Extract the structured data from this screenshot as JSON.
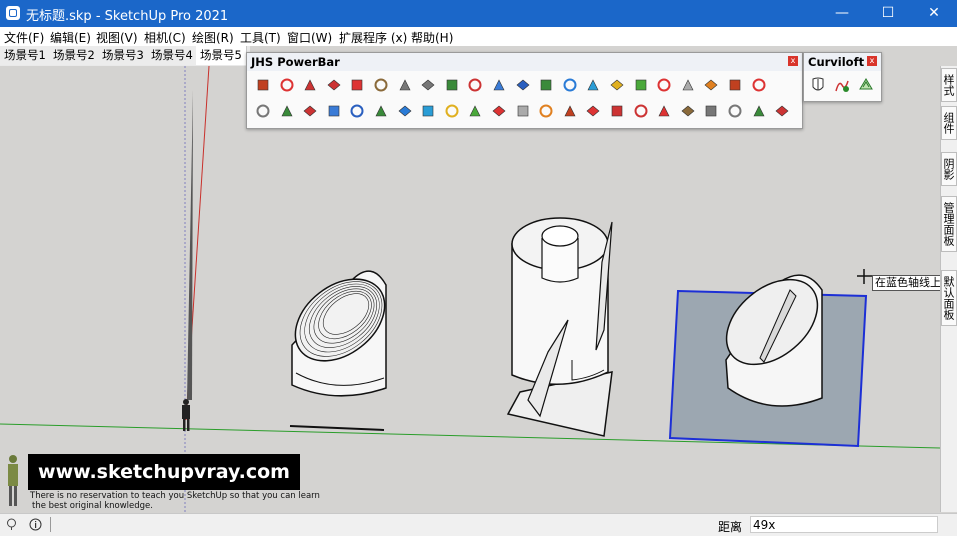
{
  "window": {
    "title": "无标题.skp - SketchUp Pro 2021",
    "minimize": "—",
    "maximize": "☐",
    "close": "✕"
  },
  "menu": [
    "文件(F)",
    "编辑(E)",
    "视图(V)",
    "相机(C)",
    "绘图(R)",
    "工具(T)",
    "窗口(W)",
    "扩展程序 (x)",
    "帮助(H)"
  ],
  "scenes": [
    "场景号1",
    "场景号2",
    "场景号3",
    "场景号4",
    "场景号5"
  ],
  "active_scene": "场景号5",
  "jhs_panel": {
    "title": "JHS PowerBar",
    "close": "x"
  },
  "curviloft_panel": {
    "title": "Curviloft",
    "close": "x"
  },
  "right_dock": [
    "样式",
    "组件",
    "阴影",
    "管理面板",
    "默认面板"
  ],
  "tooltip": "在蓝色轴线上",
  "status": {
    "measure_label": "距离",
    "measure_value": "49x"
  },
  "watermark": {
    "url": "www.sketchupvray.com",
    "line1": "There is no reservation to teach you SketchUp so that you can learn",
    "line2": "the best original knowledge."
  },
  "colors": {
    "titlebar": "#1b67c9",
    "viewport": "#d4d3d1",
    "selection": "#1c2fd6",
    "panel_bg": "#fafafa",
    "close_red": "#d9342b"
  }
}
